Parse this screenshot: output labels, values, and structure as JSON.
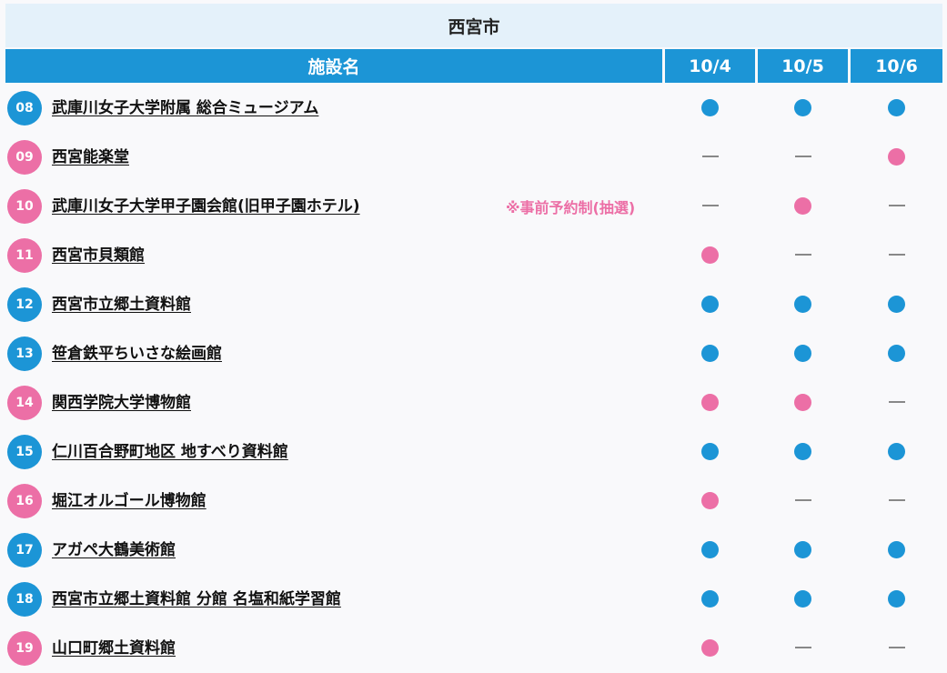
{
  "city": "西宮市",
  "columns": {
    "name": "施設名",
    "dates": [
      "10/4",
      "10/5",
      "10/6"
    ]
  },
  "colors": {
    "blue": "#1c95d6",
    "pink": "#ec6fa6",
    "header_bg": "#e4f1fa"
  },
  "rows": [
    {
      "num": "08",
      "color": "blue",
      "name": "武庫川女子大学附属 総合ミュージアム",
      "note": "",
      "days": [
        "blue",
        "blue",
        "blue"
      ]
    },
    {
      "num": "09",
      "color": "pink",
      "name": "西宮能楽堂",
      "note": "",
      "days": [
        "none",
        "none",
        "pink"
      ]
    },
    {
      "num": "10",
      "color": "pink",
      "name": "武庫川女子大学甲子園会館(旧甲子園ホテル)",
      "note": "※事前予約制(抽選)",
      "days": [
        "none",
        "pink",
        "none"
      ]
    },
    {
      "num": "11",
      "color": "pink",
      "name": "西宮市貝類館",
      "note": "",
      "days": [
        "pink",
        "none",
        "none"
      ]
    },
    {
      "num": "12",
      "color": "blue",
      "name": "西宮市立郷土資料館",
      "note": "",
      "days": [
        "blue",
        "blue",
        "blue"
      ]
    },
    {
      "num": "13",
      "color": "blue",
      "name": "笹倉鉄平ちいさな絵画館",
      "note": "",
      "days": [
        "blue",
        "blue",
        "blue"
      ]
    },
    {
      "num": "14",
      "color": "pink",
      "name": "関西学院大学博物館",
      "note": "",
      "days": [
        "pink",
        "pink",
        "none"
      ]
    },
    {
      "num": "15",
      "color": "blue",
      "name": "仁川百合野町地区 地すべり資料館",
      "note": "",
      "days": [
        "blue",
        "blue",
        "blue"
      ]
    },
    {
      "num": "16",
      "color": "pink",
      "name": "堀江オルゴール博物館",
      "note": "",
      "days": [
        "pink",
        "none",
        "none"
      ]
    },
    {
      "num": "17",
      "color": "blue",
      "name": "アガペ大鶴美術館",
      "note": "",
      "days": [
        "blue",
        "blue",
        "blue"
      ]
    },
    {
      "num": "18",
      "color": "blue",
      "name": "西宮市立郷土資料館 分館 名塩和紙学習館",
      "note": "",
      "days": [
        "blue",
        "blue",
        "blue"
      ]
    },
    {
      "num": "19",
      "color": "pink",
      "name": "山口町郷土資料館",
      "note": "",
      "days": [
        "pink",
        "none",
        "none"
      ]
    }
  ]
}
